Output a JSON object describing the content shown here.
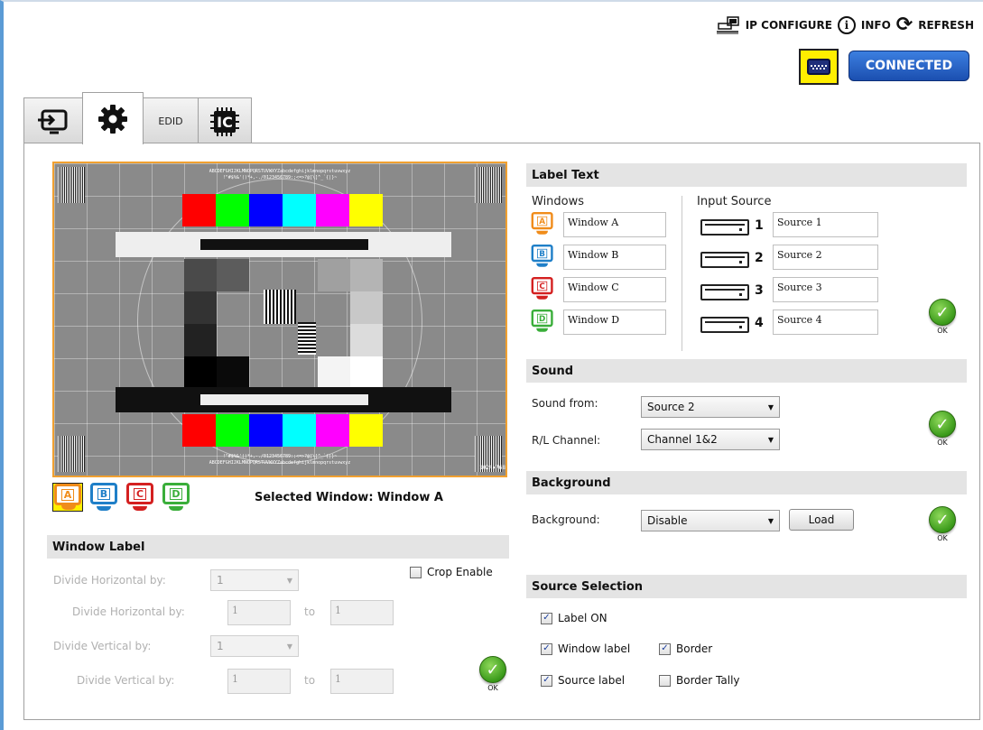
{
  "topbar": {
    "ip_configure": "IP CONFIGURE",
    "info": "INFO",
    "refresh": "REFRESH",
    "info_glyph": "i",
    "refresh_glyph": "⟳"
  },
  "status": {
    "connected": "CONNECTED"
  },
  "tabs": {
    "input": "input-tab",
    "settings": "settings-tab",
    "edid": "EDID",
    "ic": "IC"
  },
  "preview": {
    "top_text1": "ABCDEFGHIJKLMNOPQRSTUVWXYZabcdefghijklmnopqrstuvwxyz",
    "top_text2": "!\"#$%&'()*+,-./0123456789:;<=>?@[\\]^_`{|}~",
    "bottom_text1": "!\"#$%&'()*+,-./0123456789:;<=>?@[\\]^_`{|}~",
    "bottom_text2": "ABCDEFGHIJKLMNOPQRSTUVWXYZabcdefghijklmnopqrstuvwxyz",
    "resolution": "1024x768",
    "colors": [
      "#ff0000",
      "#00ff00",
      "#0000ff",
      "#00ffff",
      "#ff00ff",
      "#ffff00"
    ]
  },
  "window_selector": {
    "icons": [
      {
        "letter": "A",
        "color": "#f08c1a",
        "selected": true
      },
      {
        "letter": "B",
        "color": "#1f7fc8",
        "selected": false
      },
      {
        "letter": "C",
        "color": "#d42020",
        "selected": false
      },
      {
        "letter": "D",
        "color": "#3aae3a",
        "selected": false
      }
    ],
    "selected_text": "Selected Window: Window A"
  },
  "window_label": {
    "header": "Window Label",
    "divide_h_label": "Divide Horizontal by:",
    "divide_h_value": "1",
    "divide_h2_label": "Divide Horizontal by:",
    "divide_h_from": "1",
    "divide_h_to": "1",
    "divide_v_label": "Divide Vertical by:",
    "divide_v_value": "1",
    "divide_v2_label": "Divide Vertical by:",
    "divide_v_from": "1",
    "divide_v_to": "1",
    "to_label": "to",
    "crop_enable": "Crop Enable",
    "ok": "OK"
  },
  "label_text": {
    "header": "Label Text",
    "windows_header": "Windows",
    "input_source_header": "Input Source",
    "windows": [
      "Window A",
      "Window B",
      "Window C",
      "Window D"
    ],
    "sources": [
      {
        "num": "1",
        "name": "Source 1"
      },
      {
        "num": "2",
        "name": "Source 2"
      },
      {
        "num": "3",
        "name": "Source 3"
      },
      {
        "num": "4",
        "name": "Source 4"
      }
    ],
    "ok": "OK"
  },
  "sound": {
    "header": "Sound",
    "sound_from_label": "Sound from:",
    "sound_from_value": "Source 2",
    "channel_label": "R/L Channel:",
    "channel_value": "Channel 1&2",
    "ok": "OK"
  },
  "background": {
    "header": "Background",
    "label": "Background:",
    "value": "Disable",
    "load": "Load",
    "ok": "OK"
  },
  "source_selection": {
    "header": "Source Selection",
    "label_on": "Label ON",
    "window_label": "Window label",
    "border": "Border",
    "source_label": "Source label",
    "border_tally": "Border Tally",
    "states": {
      "label_on": true,
      "window_label": true,
      "border": true,
      "source_label": true,
      "border_tally": false
    }
  }
}
